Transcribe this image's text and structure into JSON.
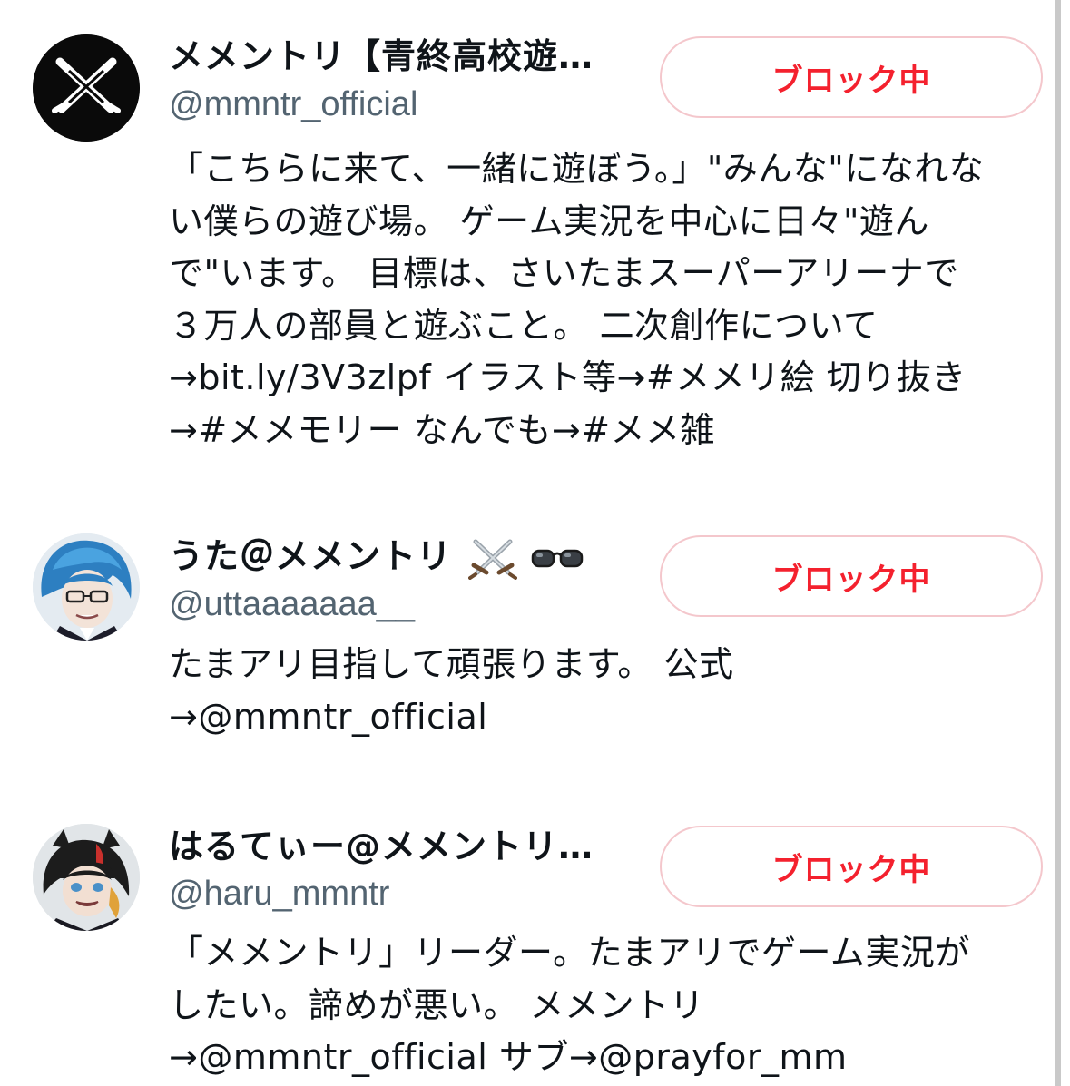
{
  "colors": {
    "block_red": "#f4212e",
    "block_border": "#f4c7cc",
    "handle_gray": "#536471",
    "text": "#0f1419"
  },
  "users": [
    {
      "name": "メメントリ【青終高校遊…",
      "handle": "@mmntr_official",
      "button_label": "ブロック中",
      "avatar_icon": "crossed-swords-logo",
      "bio_lines": [
        "「こちらに来て、一緒に遊ぼう。」\"みんな\"になれな",
        "い僕らの遊び場。 ゲーム実況を中心に日々\"遊ん",
        "で\"います。 目標は、さいたまスーパーアリーナで",
        "３万人の部員と遊ぶこと。 二次創作について",
        "→bit.ly/3V3zlpf イラスト等→#メメリ絵 切り抜き",
        "→#メメモリー なんでも→#メメ雑"
      ]
    },
    {
      "name": "うた＠メメントリ",
      "name_emojis": [
        "crossed-swords-emoji",
        "glasses-emoji"
      ],
      "handle": "@uttaaaaaaa__",
      "button_label": "ブロック中",
      "avatar_icon": "blue-hair-anime-avatar",
      "bio_lines": [
        "たまアリ目指して頑張ります。 公式",
        "→@mmntr_official"
      ]
    },
    {
      "name": "はるてぃー@メメントリ…",
      "handle": "@haru_mmntr",
      "button_label": "ブロック中",
      "avatar_icon": "dark-hair-anime-avatar",
      "bio_lines": [
        "「メメントリ」リーダー。たまアリでゲーム実況が",
        "したい。諦めが悪い。 メメントリ",
        "→@mmntr_official サブ→@prayfor_mm"
      ]
    }
  ]
}
